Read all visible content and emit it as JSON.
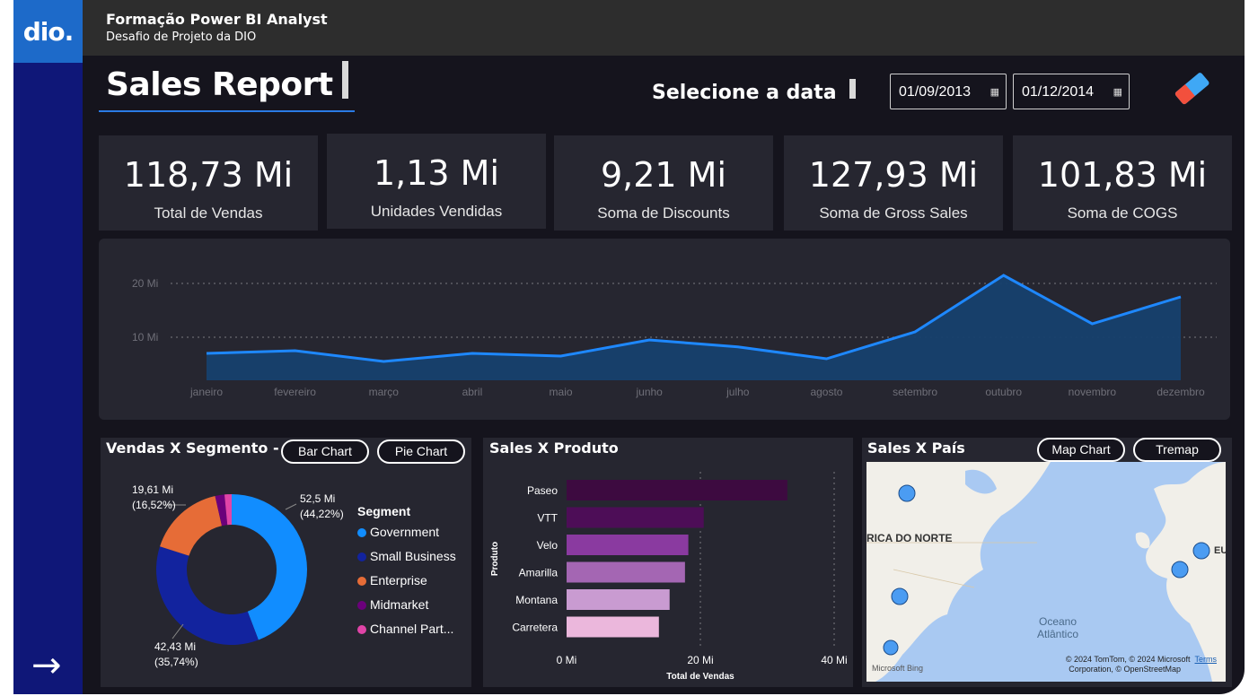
{
  "app": {
    "logo": "dio.",
    "title": "Formação Power BI Analyst",
    "subtitle": "Desafio de Projeto da DIO"
  },
  "page": {
    "title": "Sales Report",
    "date_label": "Selecione a data",
    "date_start": "01/09/2013",
    "date_end": "01/12/2014"
  },
  "kpis": [
    {
      "value": "118,73 Mi",
      "label": "Total de Vendas"
    },
    {
      "value": "1,13 Mi",
      "label": "Unidades Vendidas"
    },
    {
      "value": "9,21 Mi",
      "label": "Soma de Discounts"
    },
    {
      "value": "127,93 Mi",
      "label": "Soma de Gross Sales"
    },
    {
      "value": "101,83 Mi",
      "label": "Soma de COGS"
    }
  ],
  "colors": {
    "background": "#15141d",
    "card": "#262630",
    "accent": "#1e88ff",
    "sidebar": "#0f1778"
  },
  "chart_data": [
    {
      "type": "area",
      "title": "",
      "x": [
        "janeiro",
        "fevereiro",
        "março",
        "abril",
        "maio",
        "junho",
        "julho",
        "agosto",
        "setembro",
        "outubro",
        "novembro",
        "dezembro"
      ],
      "series": [
        {
          "values": [
            7.0,
            7.5,
            5.5,
            7.0,
            6.5,
            9.5,
            8.2,
            6.0,
            11.0,
            21.5,
            12.5,
            17.5
          ]
        }
      ],
      "yticks": [
        "10 Mi",
        "20 Mi"
      ],
      "ylim": [
        2,
        25
      ],
      "grid": true
    },
    {
      "type": "pie",
      "title": "Vendas X Segmento - Pie",
      "legend_title": "Segment",
      "categories": [
        "Government",
        "Small Business",
        "Enterprise",
        "Midmarket",
        "Channel Part..."
      ],
      "values": [
        52.5,
        42.43,
        19.61,
        2.38,
        1.81
      ],
      "colors": [
        "#118dff",
        "#12239e",
        "#e66c37",
        "#6b007b",
        "#e044a7"
      ],
      "data_labels": [
        {
          "value": "52,5 Mi",
          "pct": "(44,22%)"
        },
        {
          "value": "42,43 Mi",
          "pct": "(35,74%)"
        },
        {
          "value": "19,61 Mi",
          "pct": "(16,52%)"
        }
      ],
      "buttons": [
        "Bar Chart",
        "Pie Chart"
      ]
    },
    {
      "type": "bar",
      "title": "Sales X Produto",
      "categories": [
        "Paseo",
        "VTT",
        "Velo",
        "Amarilla",
        "Montana",
        "Carretera"
      ],
      "values": [
        33.0,
        20.5,
        18.2,
        17.7,
        15.4,
        13.8
      ],
      "colors": [
        "#3d0a40",
        "#4d0d57",
        "#8a3aa0",
        "#a466b3",
        "#c99bd1",
        "#ebb7dc"
      ],
      "xlabel": "Total de Vendas",
      "ylabel": "Produto",
      "xticks": [
        "0 Mi",
        "20 Mi",
        "40 Mi"
      ],
      "xlim": [
        0,
        40
      ]
    }
  ],
  "map": {
    "title": "Sales X País",
    "buttons": [
      "Map Chart",
      "Tremap"
    ],
    "region_label": "RICA DO NORTE",
    "ocean_label_1": "Oceano",
    "ocean_label_2": "Atlântico",
    "eu_label": "EU",
    "attribution_1": "© 2024 TomTom, © 2024 Microsoft",
    "attribution_terms": "Terms",
    "attribution_2": "Corporation, © OpenStreetMap",
    "bing": "Microsoft Bing"
  }
}
